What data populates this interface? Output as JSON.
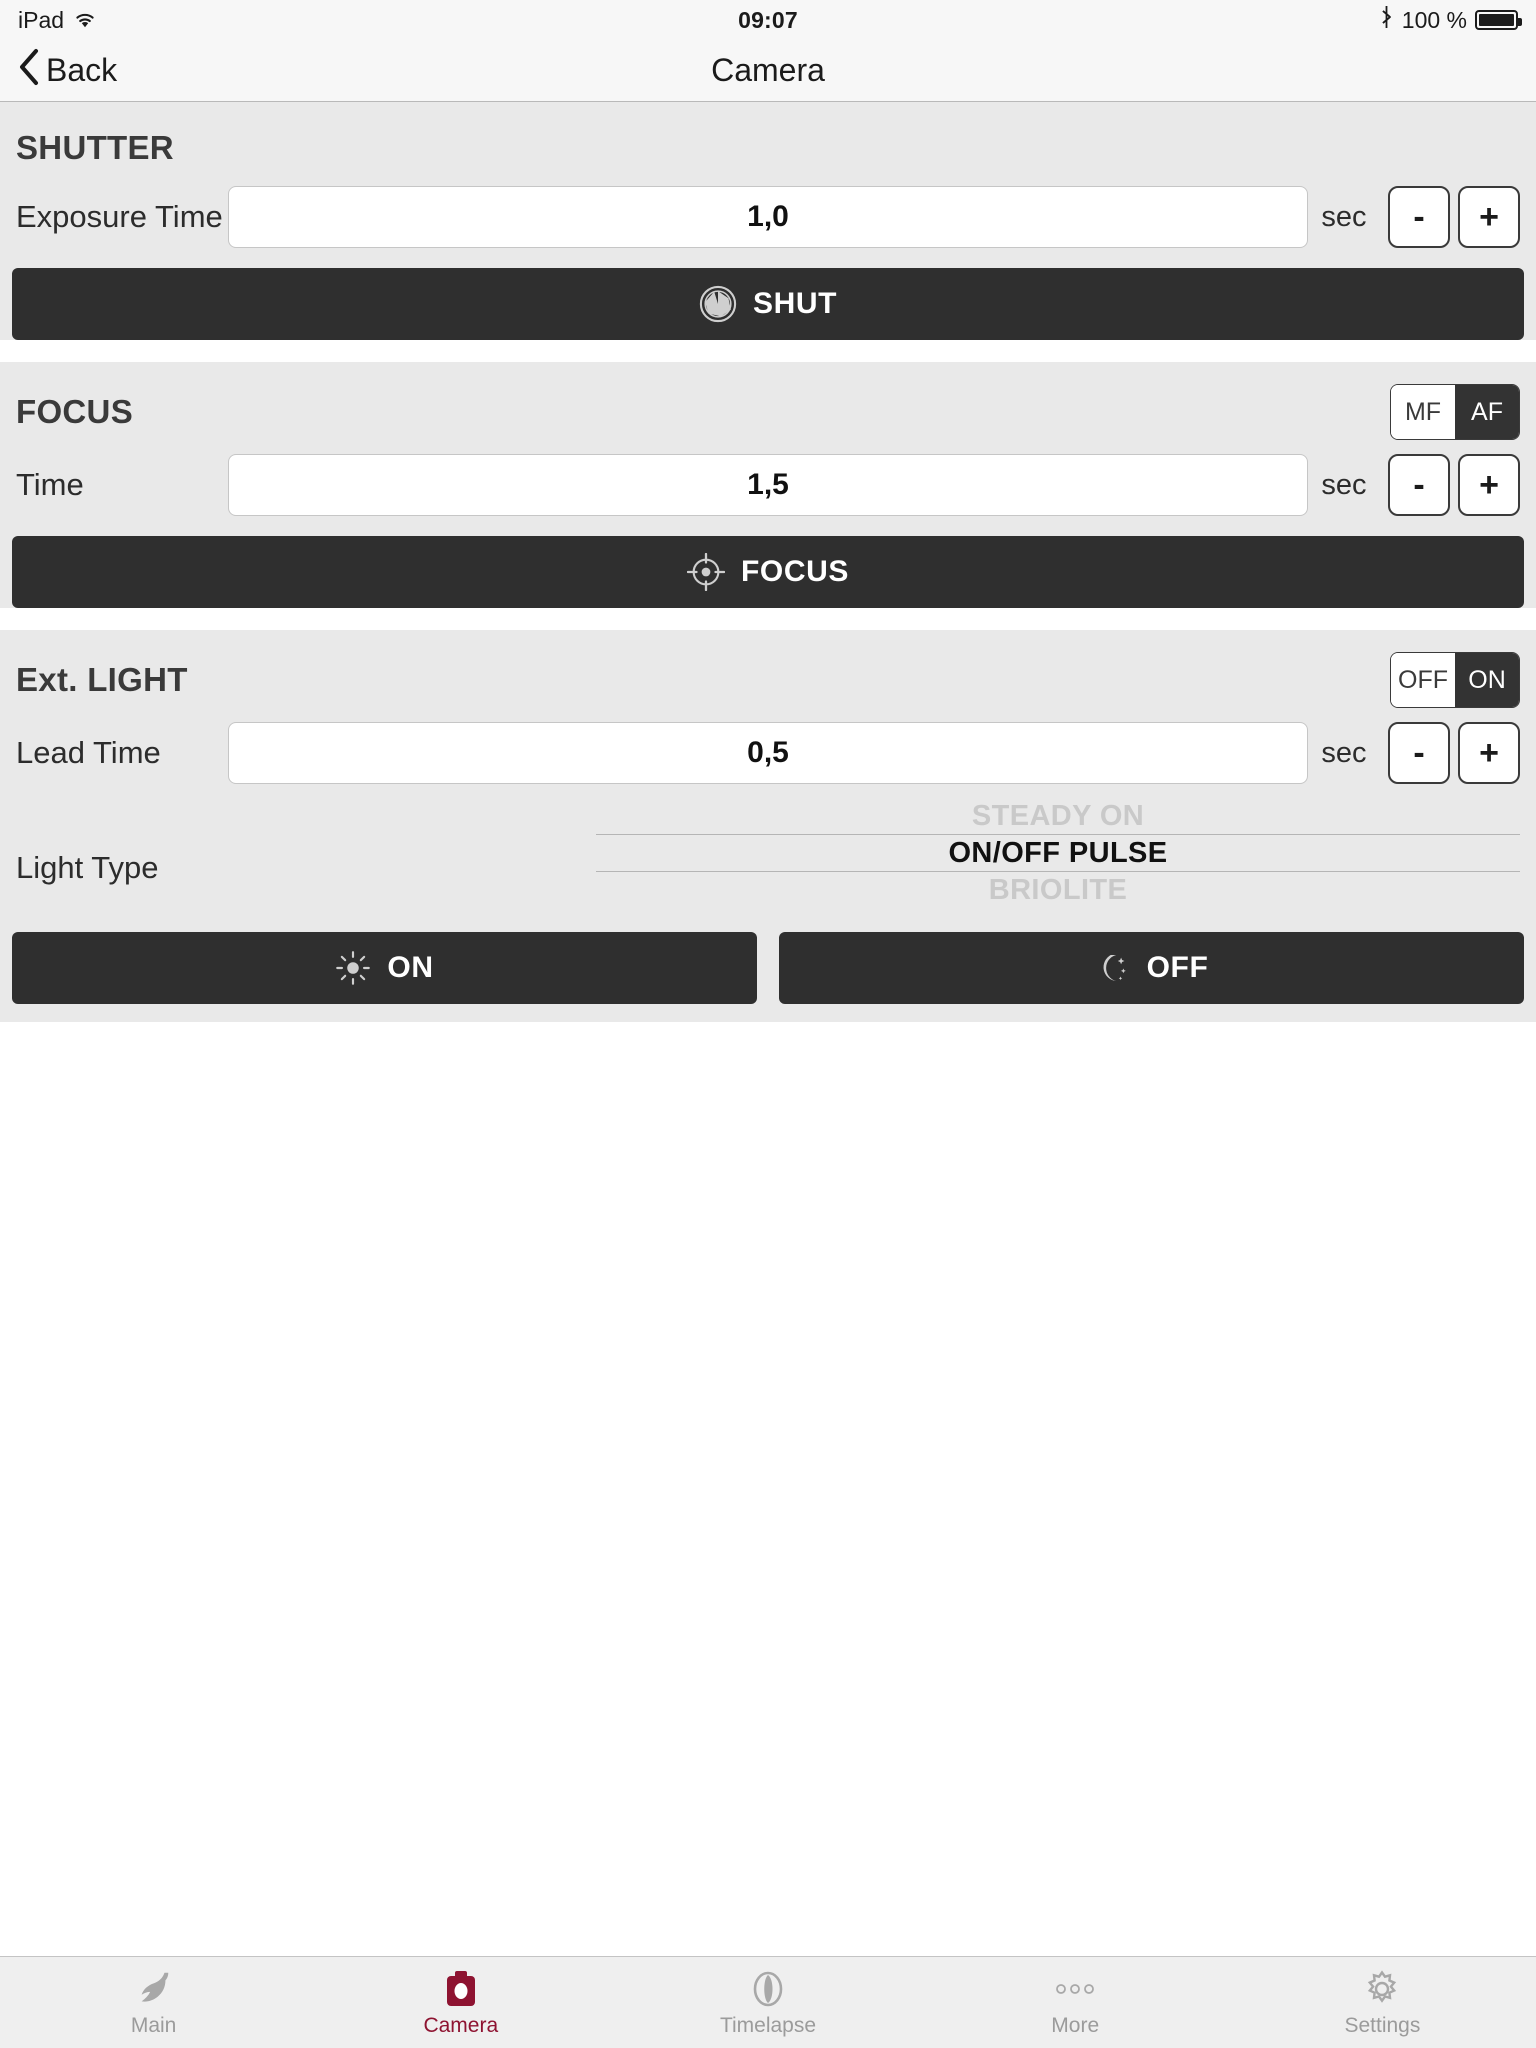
{
  "status_bar": {
    "device": "iPad",
    "wifi_icon": "wifi-icon",
    "time": "09:07",
    "bluetooth_icon": "bluetooth-icon",
    "battery_percent": "100 %"
  },
  "nav": {
    "back_label": "Back",
    "back_icon": "chevron-left-icon",
    "title": "Camera"
  },
  "shutter": {
    "title": "SHUTTER",
    "exposure_label": "Exposure Time",
    "exposure_value": "1,0",
    "unit": "sec",
    "minus": "-",
    "plus": "+",
    "button_label": "SHUT",
    "button_icon": "aperture-icon"
  },
  "focus": {
    "title": "FOCUS",
    "mode_options": [
      "MF",
      "AF"
    ],
    "mode_selected": "AF",
    "time_label": "Time",
    "time_value": "1,5",
    "unit": "sec",
    "minus": "-",
    "plus": "+",
    "button_label": "FOCUS",
    "button_icon": "crosshair-icon"
  },
  "ext_light": {
    "title": "Ext. LIGHT",
    "power_options": [
      "OFF",
      "ON"
    ],
    "power_selected": "ON",
    "lead_time_label": "Lead Time",
    "lead_time_value": "0,5",
    "unit": "sec",
    "minus": "-",
    "plus": "+",
    "light_type_label": "Light Type",
    "light_type_options": [
      "STEADY ON",
      "ON/OFF PULSE",
      "BRIOLITE"
    ],
    "light_type_selected": "ON/OFF PULSE",
    "on_button_label": "ON",
    "on_button_icon": "sun-icon",
    "off_button_label": "OFF",
    "off_button_icon": "moon-stars-icon"
  },
  "tabbar": {
    "items": [
      {
        "label": "Main",
        "icon": "bird-icon",
        "active": false
      },
      {
        "label": "Camera",
        "icon": "camera-icon",
        "active": true
      },
      {
        "label": "Timelapse",
        "icon": "timelapse-icon",
        "active": false
      },
      {
        "label": "More",
        "icon": "ellipsis-icon",
        "active": false
      },
      {
        "label": "Settings",
        "icon": "gear-icon",
        "active": false
      }
    ]
  },
  "colors": {
    "accent": "#8e1331",
    "section_bg": "#e9e9e9",
    "dark_button": "#2f2f2f"
  }
}
